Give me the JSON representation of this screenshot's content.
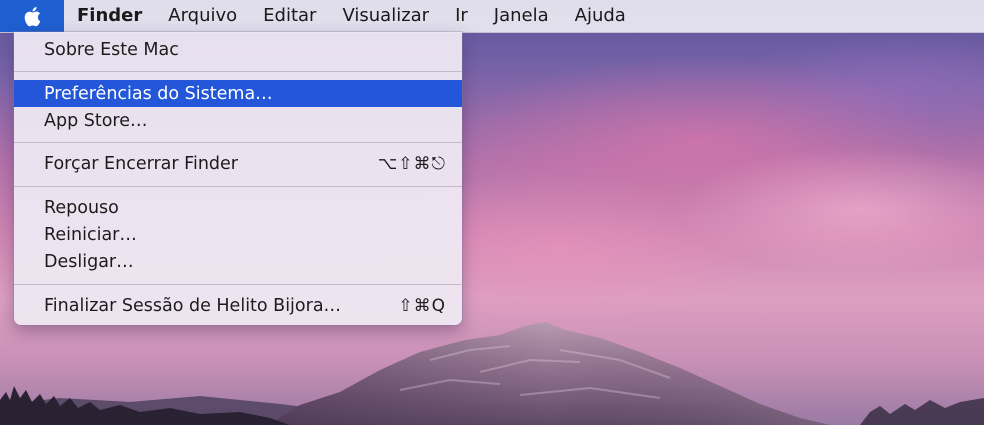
{
  "menubar": {
    "apple_icon": "apple-logo-icon",
    "menus": [
      "Finder",
      "Arquivo",
      "Editar",
      "Visualizar",
      "Ir",
      "Janela",
      "Ajuda"
    ]
  },
  "apple_menu": {
    "items": [
      {
        "label": "Sobre Este Mac",
        "shortcut": ""
      },
      {
        "label": "Preferências do Sistema…",
        "shortcut": "",
        "highlighted": true
      },
      {
        "label": "App Store…",
        "shortcut": ""
      },
      {
        "label": "Forçar Encerrar Finder",
        "shortcut": "⌥⇧⌘⎋"
      },
      {
        "label": "Repouso",
        "shortcut": ""
      },
      {
        "label": "Reiniciar…",
        "shortcut": ""
      },
      {
        "label": "Desligar…",
        "shortcut": ""
      },
      {
        "label": "Finalizar Sessão de Helito Bijora…",
        "shortcut": "⇧⌘Q"
      }
    ]
  },
  "colors": {
    "highlight": "#2356d8",
    "apple_tab": "#1f5fd1"
  }
}
